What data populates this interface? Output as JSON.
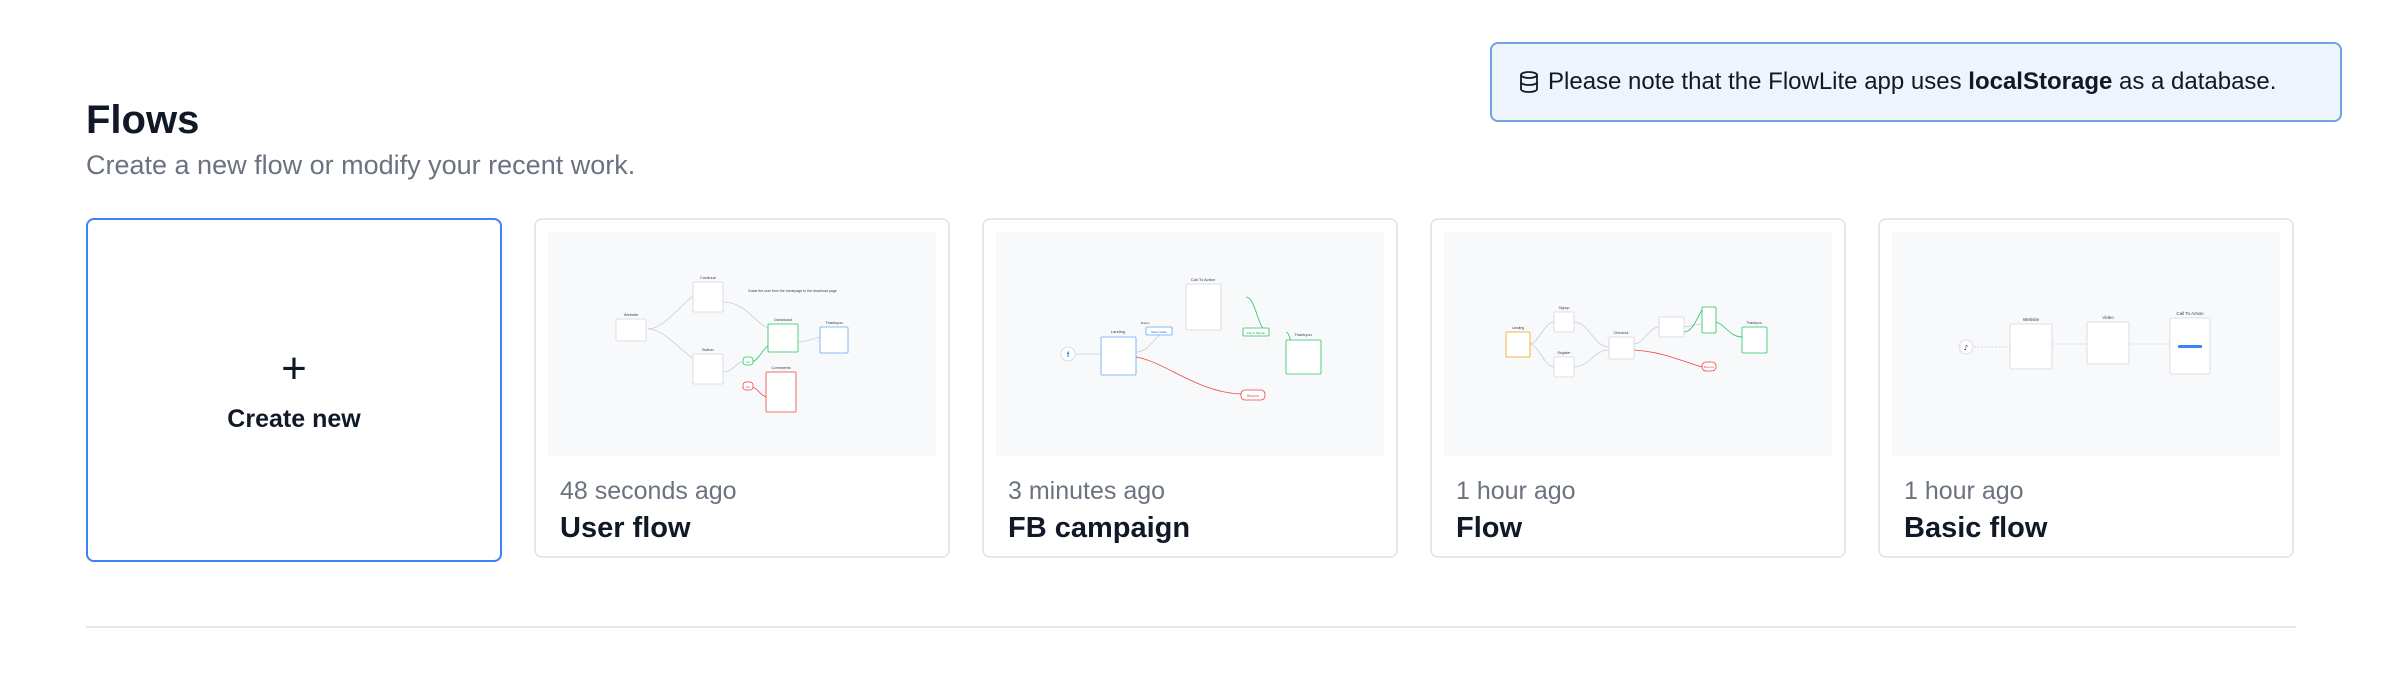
{
  "notice": {
    "prefix": "Please note that the FlowLite app uses ",
    "bold": "localStorage",
    "suffix": " as a database.",
    "icon": "database-icon"
  },
  "header": {
    "title": "Flows",
    "subtitle": "Create a new flow or modify your recent work."
  },
  "create": {
    "icon": "+",
    "label": "Create new"
  },
  "flows": [
    {
      "time": "48 seconds ago",
      "name": "User flow",
      "preview": {
        "nodes": [
          "Website",
          "Continue",
          "Download",
          "Thankyou",
          "Button",
          "Yes",
          "No",
          "Comments"
        ],
        "annotation": "Guide the user from the homepage to the download page"
      }
    },
    {
      "time": "3 minutes ago",
      "name": "FB campaign",
      "preview": {
        "nodes": [
          "Landing",
          "Call To Action",
          "Thankyou",
          "Button",
          "Show Video",
          "Pay & Signup",
          "Bounce"
        ]
      }
    },
    {
      "time": "1 hour ago",
      "name": "Flow",
      "preview": {
        "nodes": [
          "Landing",
          "Signup",
          "Register",
          "Checkout",
          "Thankyou",
          "Bounce"
        ]
      }
    },
    {
      "time": "1 hour ago",
      "name": "Basic flow",
      "preview": {
        "nodes": [
          "Website",
          "Video",
          "Call To Action"
        ]
      }
    }
  ],
  "colors": {
    "accent": "#3b82f6",
    "notice_bg": "#eef4fb",
    "notice_border": "#6fa3e6",
    "muted_text": "#6b7280",
    "card_border": "#e5e7eb",
    "preview_green": "#22c55e",
    "preview_red": "#ef4444",
    "preview_blue": "#60a5fa",
    "preview_orange": "#f59e0b"
  }
}
